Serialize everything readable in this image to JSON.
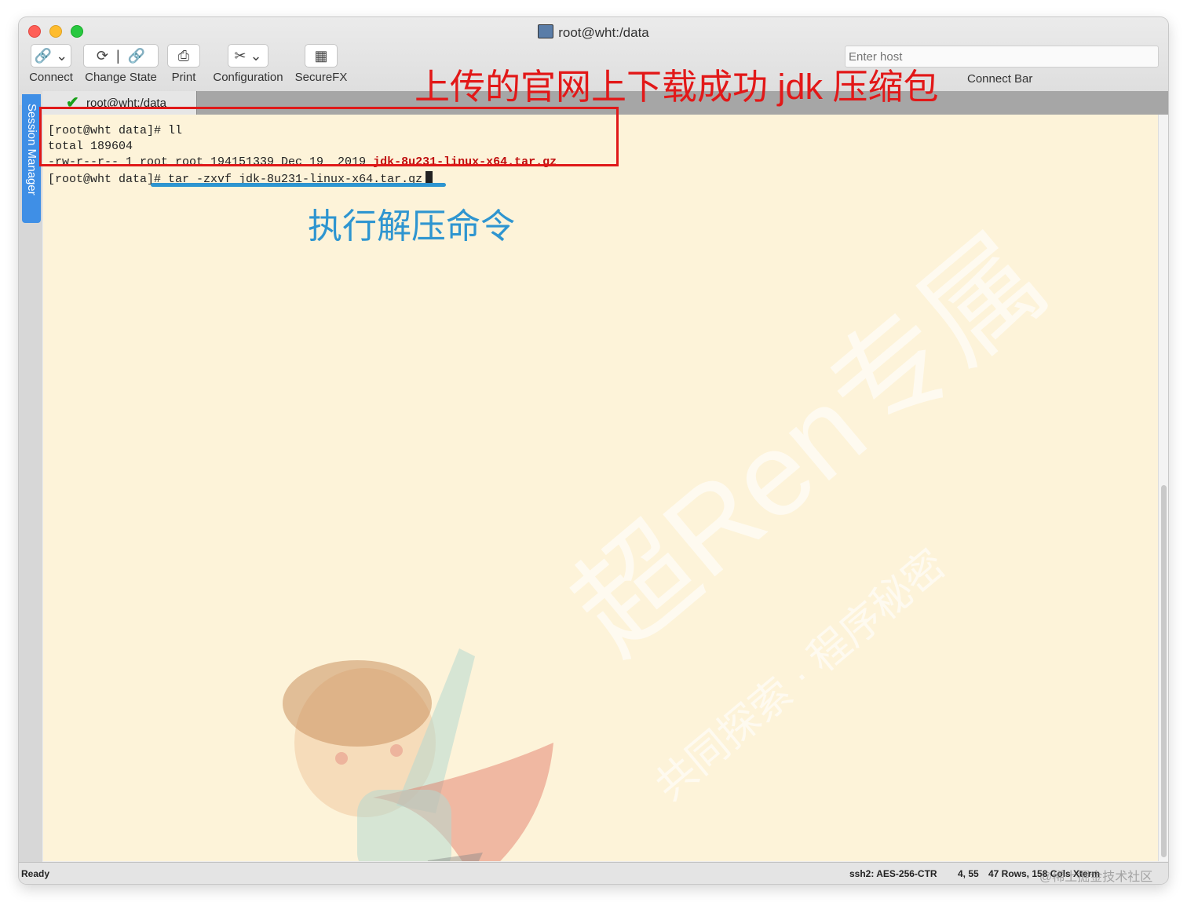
{
  "window": {
    "title": "root@wht:/data"
  },
  "toolbar": {
    "items": [
      {
        "label": "Connect",
        "icon": "link-icon"
      },
      {
        "label": "Change State",
        "icon": "reconnect-icon"
      },
      {
        "label": "Print",
        "icon": "printer-icon"
      },
      {
        "label": "Configuration",
        "icon": "tools-icon"
      },
      {
        "label": "SecureFX",
        "icon": "securefx-icon"
      }
    ],
    "host_placeholder": "Enter host",
    "connect_bar_label": "Connect Bar"
  },
  "tab": {
    "label": "root@wht:/data",
    "status": "connected"
  },
  "session_manager": {
    "label": "Session Manager"
  },
  "terminal": {
    "lines": [
      "[root@wht data]# ll",
      "total 189604",
      "-rw-r--r-- 1 root root 194151339 Dec 19  2019 ",
      "[root@wht data]# tar -zxvf jdk-8u231-linux-x64.tar.gz"
    ],
    "highlight_file": "jdk-8u231-linux-x64.tar.gz"
  },
  "annotations": {
    "red_text": "上传的官网上下载成功 jdk 压缩包",
    "blue_text": "执行解压命令",
    "red_color": "#e21818",
    "blue_color": "#2e95d0"
  },
  "watermark": {
    "main": "超Ren专属",
    "sub": "共同探索 · 程序秘密",
    "corner": "@稀土掘金技术社区"
  },
  "status": {
    "ready": "Ready",
    "cipher": "ssh2: AES-256-CTR",
    "cursor_pos": "4, 55",
    "dimensions": "47 Rows, 158 Cols   Xterm"
  }
}
